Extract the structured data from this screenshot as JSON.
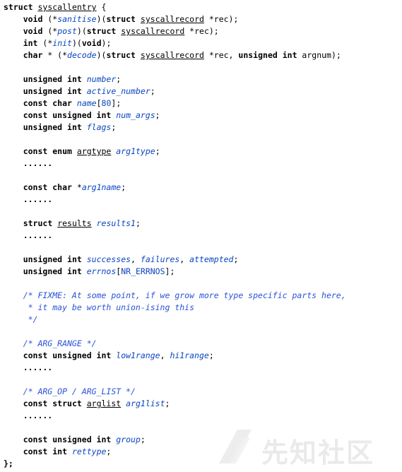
{
  "code_lines": [
    [
      {
        "t": "struct",
        "c": "kw"
      },
      {
        "t": " ",
        "c": "plain"
      },
      {
        "t": "syscallentry",
        "c": "type"
      },
      {
        "t": " {",
        "c": "plain"
      }
    ],
    [
      {
        "t": "    ",
        "c": "plain"
      },
      {
        "t": "void",
        "c": "kw"
      },
      {
        "t": " (*",
        "c": "plain"
      },
      {
        "t": "sanitise",
        "c": "var"
      },
      {
        "t": ")(",
        "c": "plain"
      },
      {
        "t": "struct",
        "c": "kw"
      },
      {
        "t": " ",
        "c": "plain"
      },
      {
        "t": "syscallrecord",
        "c": "type"
      },
      {
        "t": " *rec);",
        "c": "plain"
      }
    ],
    [
      {
        "t": "    ",
        "c": "plain"
      },
      {
        "t": "void",
        "c": "kw"
      },
      {
        "t": " (*",
        "c": "plain"
      },
      {
        "t": "post",
        "c": "var"
      },
      {
        "t": ")(",
        "c": "plain"
      },
      {
        "t": "struct",
        "c": "kw"
      },
      {
        "t": " ",
        "c": "plain"
      },
      {
        "t": "syscallrecord",
        "c": "type"
      },
      {
        "t": " *rec);",
        "c": "plain"
      }
    ],
    [
      {
        "t": "    ",
        "c": "plain"
      },
      {
        "t": "int",
        "c": "kw"
      },
      {
        "t": " (*",
        "c": "plain"
      },
      {
        "t": "init",
        "c": "var"
      },
      {
        "t": ")(",
        "c": "plain"
      },
      {
        "t": "void",
        "c": "kw"
      },
      {
        "t": ");",
        "c": "plain"
      }
    ],
    [
      {
        "t": "    ",
        "c": "plain"
      },
      {
        "t": "char",
        "c": "kw"
      },
      {
        "t": " * (*",
        "c": "plain"
      },
      {
        "t": "decode",
        "c": "var"
      },
      {
        "t": ")(",
        "c": "plain"
      },
      {
        "t": "struct",
        "c": "kw"
      },
      {
        "t": " ",
        "c": "plain"
      },
      {
        "t": "syscallrecord",
        "c": "type"
      },
      {
        "t": " *rec, ",
        "c": "plain"
      },
      {
        "t": "unsigned int",
        "c": "kw"
      },
      {
        "t": " argnum);",
        "c": "plain"
      }
    ],
    [],
    [
      {
        "t": "    ",
        "c": "plain"
      },
      {
        "t": "unsigned int",
        "c": "kw"
      },
      {
        "t": " ",
        "c": "plain"
      },
      {
        "t": "number",
        "c": "var"
      },
      {
        "t": ";",
        "c": "plain"
      }
    ],
    [
      {
        "t": "    ",
        "c": "plain"
      },
      {
        "t": "unsigned int",
        "c": "kw"
      },
      {
        "t": " ",
        "c": "plain"
      },
      {
        "t": "active_number",
        "c": "var"
      },
      {
        "t": ";",
        "c": "plain"
      }
    ],
    [
      {
        "t": "    ",
        "c": "plain"
      },
      {
        "t": "const char",
        "c": "kw"
      },
      {
        "t": " ",
        "c": "plain"
      },
      {
        "t": "name",
        "c": "var"
      },
      {
        "t": "[",
        "c": "plain"
      },
      {
        "t": "80",
        "c": "num"
      },
      {
        "t": "];",
        "c": "plain"
      }
    ],
    [
      {
        "t": "    ",
        "c": "plain"
      },
      {
        "t": "const unsigned int",
        "c": "kw"
      },
      {
        "t": " ",
        "c": "plain"
      },
      {
        "t": "num_args",
        "c": "var"
      },
      {
        "t": ";",
        "c": "plain"
      }
    ],
    [
      {
        "t": "    ",
        "c": "plain"
      },
      {
        "t": "unsigned int",
        "c": "kw"
      },
      {
        "t": " ",
        "c": "plain"
      },
      {
        "t": "flags",
        "c": "var"
      },
      {
        "t": ";",
        "c": "plain"
      }
    ],
    [],
    [
      {
        "t": "    ",
        "c": "plain"
      },
      {
        "t": "const enum",
        "c": "kw"
      },
      {
        "t": " ",
        "c": "plain"
      },
      {
        "t": "argtype",
        "c": "type"
      },
      {
        "t": " ",
        "c": "plain"
      },
      {
        "t": "arg1type",
        "c": "var"
      },
      {
        "t": ";",
        "c": "plain"
      }
    ],
    [
      {
        "t": "    ......",
        "c": "kw"
      }
    ],
    [],
    [
      {
        "t": "    ",
        "c": "plain"
      },
      {
        "t": "const char",
        "c": "kw"
      },
      {
        "t": " *",
        "c": "plain"
      },
      {
        "t": "arg1name",
        "c": "var"
      },
      {
        "t": ";",
        "c": "plain"
      }
    ],
    [
      {
        "t": "    ......",
        "c": "kw"
      }
    ],
    [],
    [
      {
        "t": "    ",
        "c": "plain"
      },
      {
        "t": "struct",
        "c": "kw"
      },
      {
        "t": " ",
        "c": "plain"
      },
      {
        "t": "results",
        "c": "type"
      },
      {
        "t": " ",
        "c": "plain"
      },
      {
        "t": "results1",
        "c": "var"
      },
      {
        "t": ";",
        "c": "plain"
      }
    ],
    [
      {
        "t": "    ......",
        "c": "kw"
      }
    ],
    [],
    [
      {
        "t": "    ",
        "c": "plain"
      },
      {
        "t": "unsigned int",
        "c": "kw"
      },
      {
        "t": " ",
        "c": "plain"
      },
      {
        "t": "successes",
        "c": "var"
      },
      {
        "t": ", ",
        "c": "plain"
      },
      {
        "t": "failures",
        "c": "var"
      },
      {
        "t": ", ",
        "c": "plain"
      },
      {
        "t": "attempted",
        "c": "var"
      },
      {
        "t": ";",
        "c": "plain"
      }
    ],
    [
      {
        "t": "    ",
        "c": "plain"
      },
      {
        "t": "unsigned int",
        "c": "kw"
      },
      {
        "t": " ",
        "c": "plain"
      },
      {
        "t": "errnos",
        "c": "var"
      },
      {
        "t": "[",
        "c": "plain"
      },
      {
        "t": "NR_ERRNOS",
        "c": "num"
      },
      {
        "t": "];",
        "c": "plain"
      }
    ],
    [],
    [
      {
        "t": "    /* FIXME: At some point, if we grow more type specific parts here,",
        "c": "cmt"
      }
    ],
    [
      {
        "t": "     * it may be worth union-ising this",
        "c": "cmt"
      }
    ],
    [
      {
        "t": "     */",
        "c": "cmt"
      }
    ],
    [],
    [
      {
        "t": "    /* ARG_RANGE */",
        "c": "cmt"
      }
    ],
    [
      {
        "t": "    ",
        "c": "plain"
      },
      {
        "t": "const unsigned int",
        "c": "kw"
      },
      {
        "t": " ",
        "c": "plain"
      },
      {
        "t": "low1range",
        "c": "var"
      },
      {
        "t": ", ",
        "c": "plain"
      },
      {
        "t": "hi1range",
        "c": "var"
      },
      {
        "t": ";",
        "c": "plain"
      }
    ],
    [
      {
        "t": "    ......",
        "c": "kw"
      }
    ],
    [],
    [
      {
        "t": "    /* ARG_OP / ARG_LIST */",
        "c": "cmt"
      }
    ],
    [
      {
        "t": "    ",
        "c": "plain"
      },
      {
        "t": "const struct",
        "c": "kw"
      },
      {
        "t": " ",
        "c": "plain"
      },
      {
        "t": "arglist",
        "c": "type"
      },
      {
        "t": " ",
        "c": "plain"
      },
      {
        "t": "arg1list",
        "c": "var"
      },
      {
        "t": ";",
        "c": "plain"
      }
    ],
    [
      {
        "t": "    ......",
        "c": "kw"
      }
    ],
    [],
    [
      {
        "t": "    ",
        "c": "plain"
      },
      {
        "t": "const unsigned int",
        "c": "kw"
      },
      {
        "t": " ",
        "c": "plain"
      },
      {
        "t": "group",
        "c": "var"
      },
      {
        "t": ";",
        "c": "plain"
      }
    ],
    [
      {
        "t": "    ",
        "c": "plain"
      },
      {
        "t": "const int",
        "c": "kw"
      },
      {
        "t": " ",
        "c": "plain"
      },
      {
        "t": "rettype",
        "c": "var"
      },
      {
        "t": ";",
        "c": "plain"
      }
    ],
    [
      {
        "t": "};",
        "c": "kw"
      }
    ]
  ],
  "watermark": {
    "text": "先知社区",
    "icon": "xianzhi-logo-icon"
  },
  "colors": {
    "background": "#ffffff",
    "keyword": "#000000",
    "identifier": "#0b45c0",
    "comment": "#2a52d6",
    "watermark": "#d9d9d9"
  }
}
